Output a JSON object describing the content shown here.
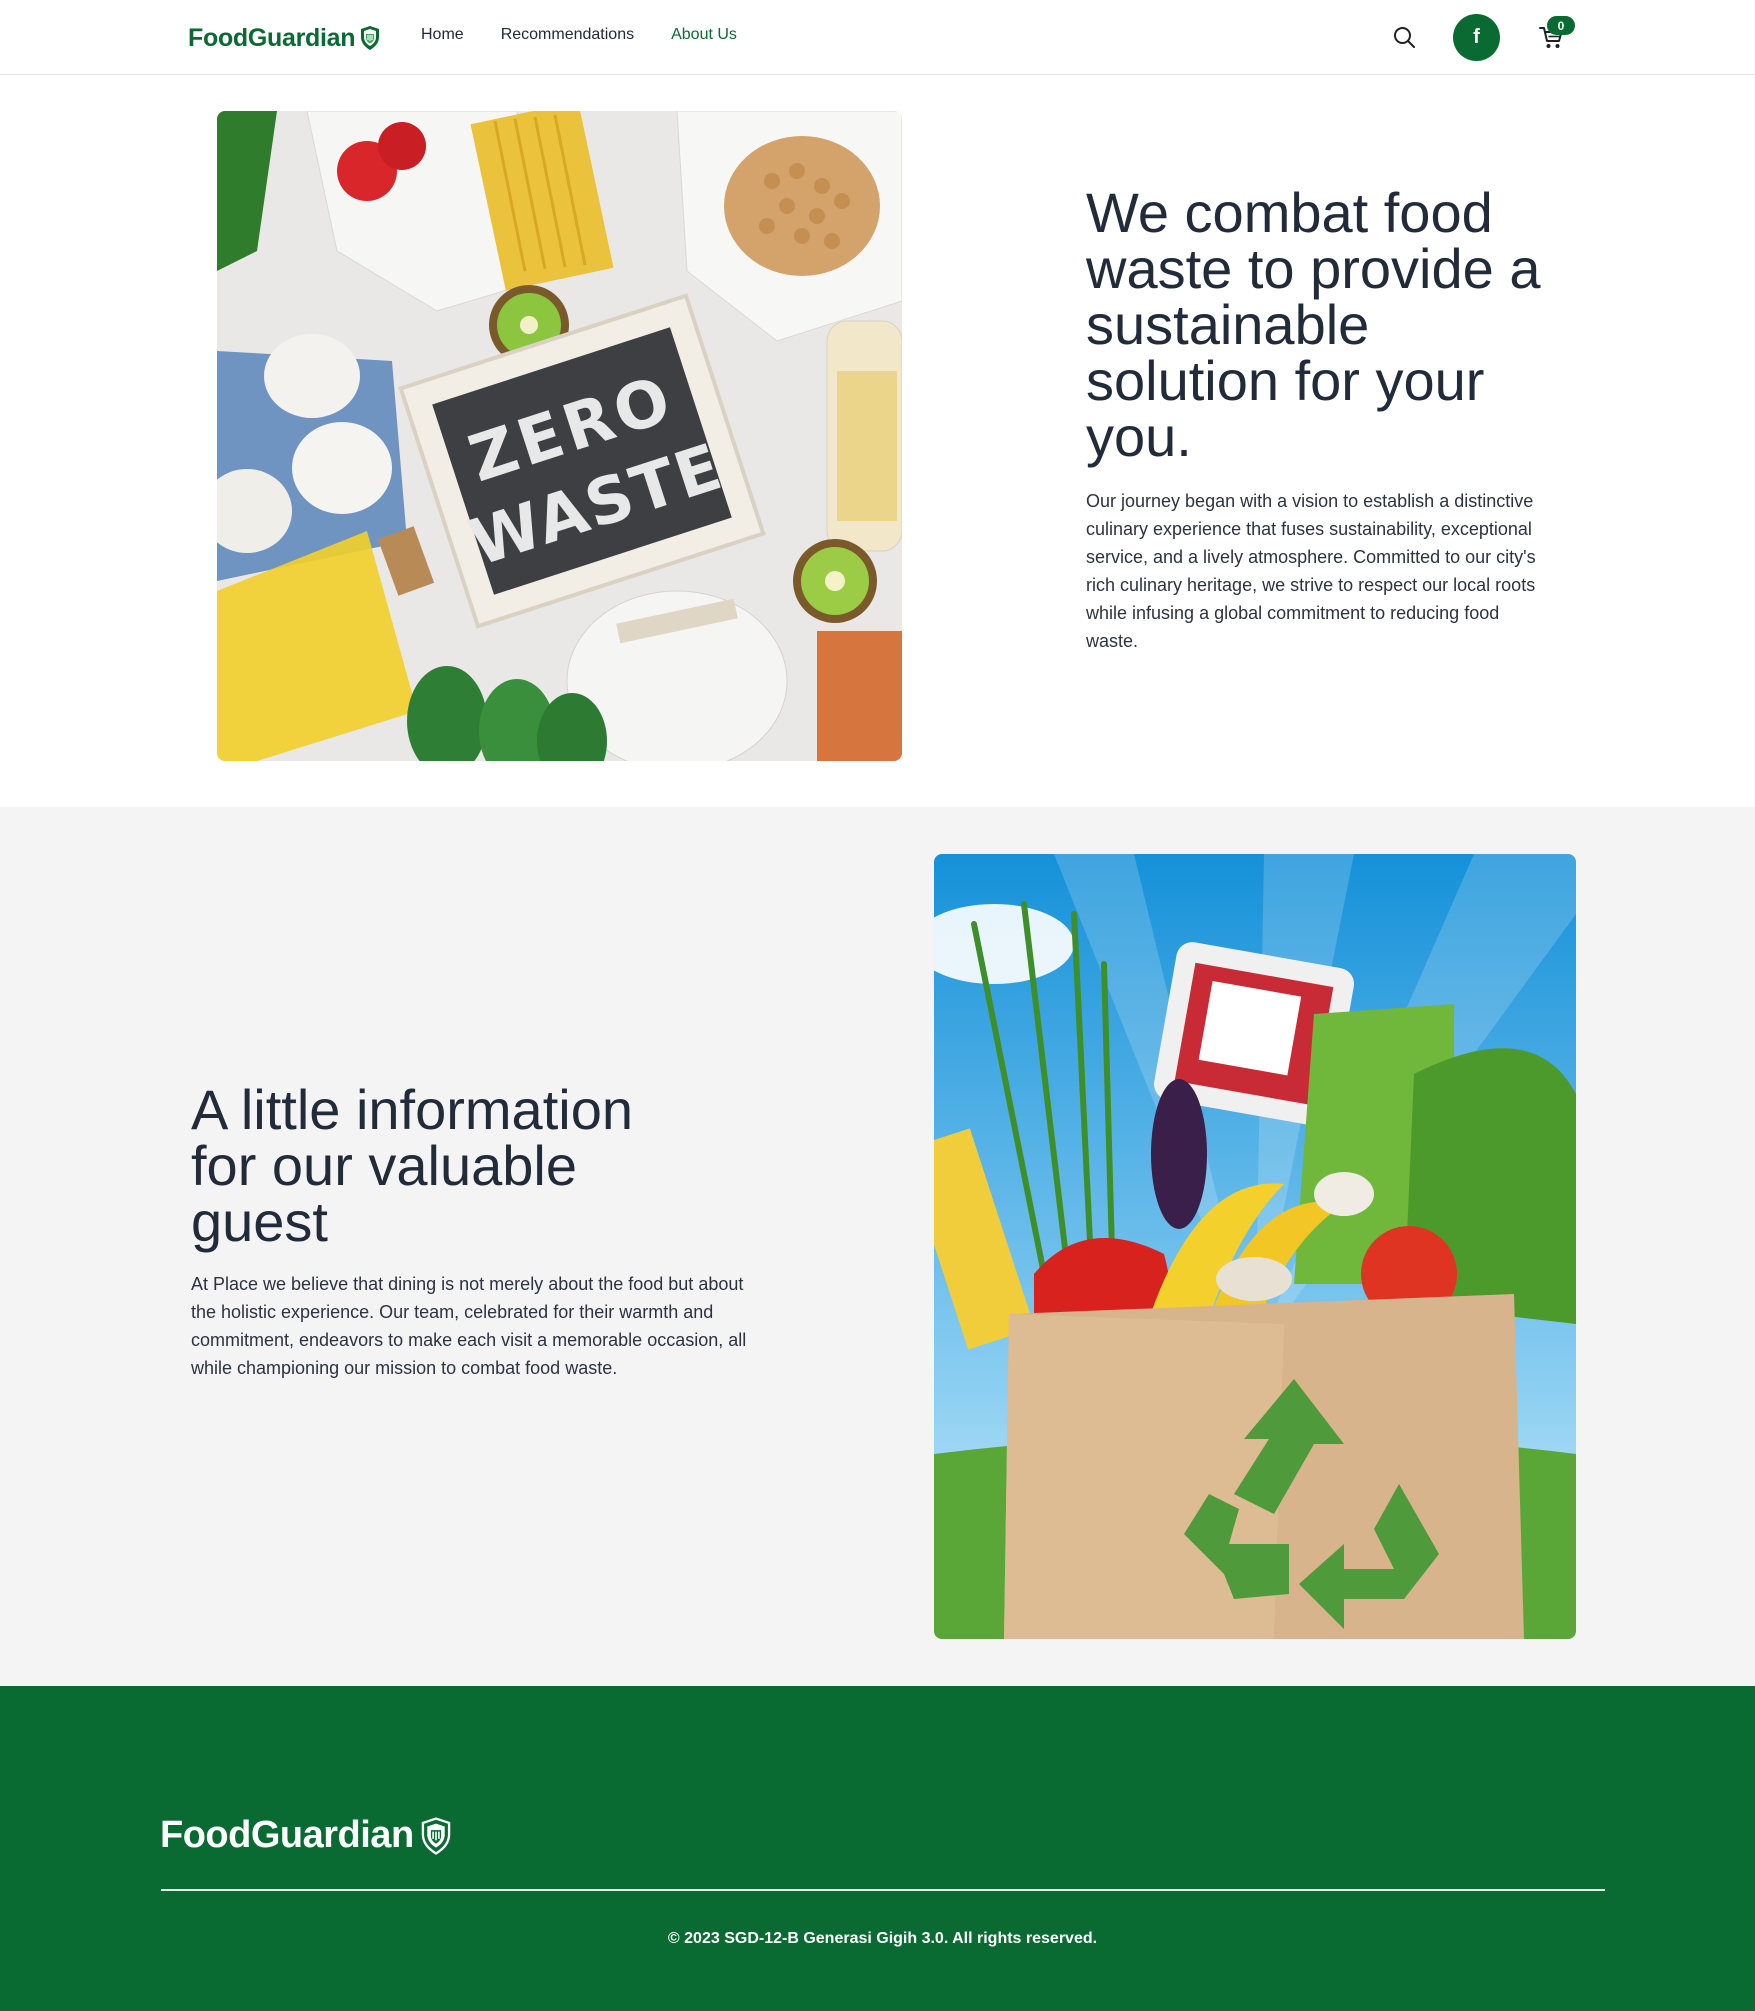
{
  "brand": {
    "name": "FoodGuardian",
    "primary_color": "#0a6b32"
  },
  "header": {
    "nav": [
      {
        "label": "Home",
        "active": false
      },
      {
        "label": "Recommendations",
        "active": false
      },
      {
        "label": "About Us",
        "active": true
      }
    ],
    "search_icon": "search-icon",
    "avatar_initial": "f",
    "cart_icon": "cart-icon",
    "cart_count": "0"
  },
  "about": {
    "heading": "We combat food waste to provide a sustainable solution for your you.",
    "body": "Our journey began with a vision to establish a distinctive culinary experience that fuses sustainability, exceptional service, and a lively atmosphere. Committed to our city's rich culinary heritage, we strive to respect our local roots while infusing a global commitment to reducing food waste.",
    "image_sign_text": "ZERO WASTE"
  },
  "info": {
    "heading": "A little information for our valuable guest",
    "body": "At Place we believe that dining is not merely about the food but about the holistic experience. Our team, celebrated for their warmth and commitment, endeavors to make each visit a memorable occasion, all while championing our mission to combat food waste."
  },
  "footer": {
    "brand": "FoodGuardian",
    "copyright": "© 2023 SGD-12-B Generasi Gigih 3.0. All rights reserved."
  }
}
